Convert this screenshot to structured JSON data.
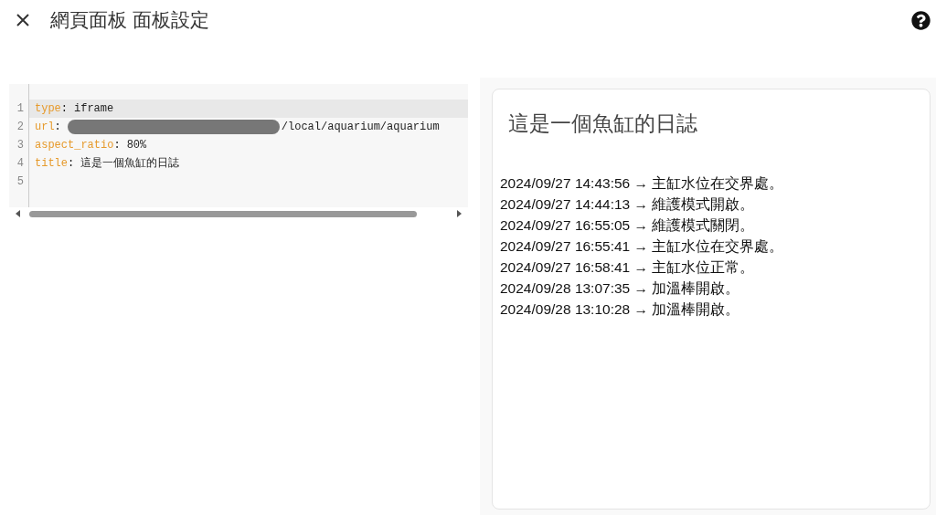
{
  "header": {
    "title": "網頁面板 面板設定"
  },
  "editor": {
    "lines": [
      {
        "number": "1",
        "key": "type",
        "separator": ":",
        "value": "iframe",
        "redacted": false,
        "active": true
      },
      {
        "number": "2",
        "key": "url",
        "separator": ":",
        "value": "/local/aquarium/aquarium",
        "redacted": true,
        "active": false
      },
      {
        "number": "3",
        "key": "aspect_ratio",
        "separator": ":",
        "value": "80%",
        "redacted": false,
        "active": false
      },
      {
        "number": "4",
        "key": "title",
        "separator": ":",
        "value": "這是一個魚缸的日誌",
        "redacted": false,
        "active": false
      },
      {
        "number": "5",
        "active": false
      }
    ]
  },
  "preview": {
    "title": "這是一個魚缸的日誌",
    "log": [
      "2024/09/27 14:43:56 → 主缸水位在交界處。",
      "2024/09/27 14:44:13 → 維護模式開啟。",
      "2024/09/27 16:55:05 → 維護模式關閉。",
      "2024/09/27 16:55:41 → 主缸水位在交界處。",
      "2024/09/27 16:58:41 → 主缸水位正常。",
      "2024/09/28 13:07:35 → 加溫棒開啟。",
      "2024/09/28 13:10:28 → 加溫棒開啟。"
    ]
  }
}
